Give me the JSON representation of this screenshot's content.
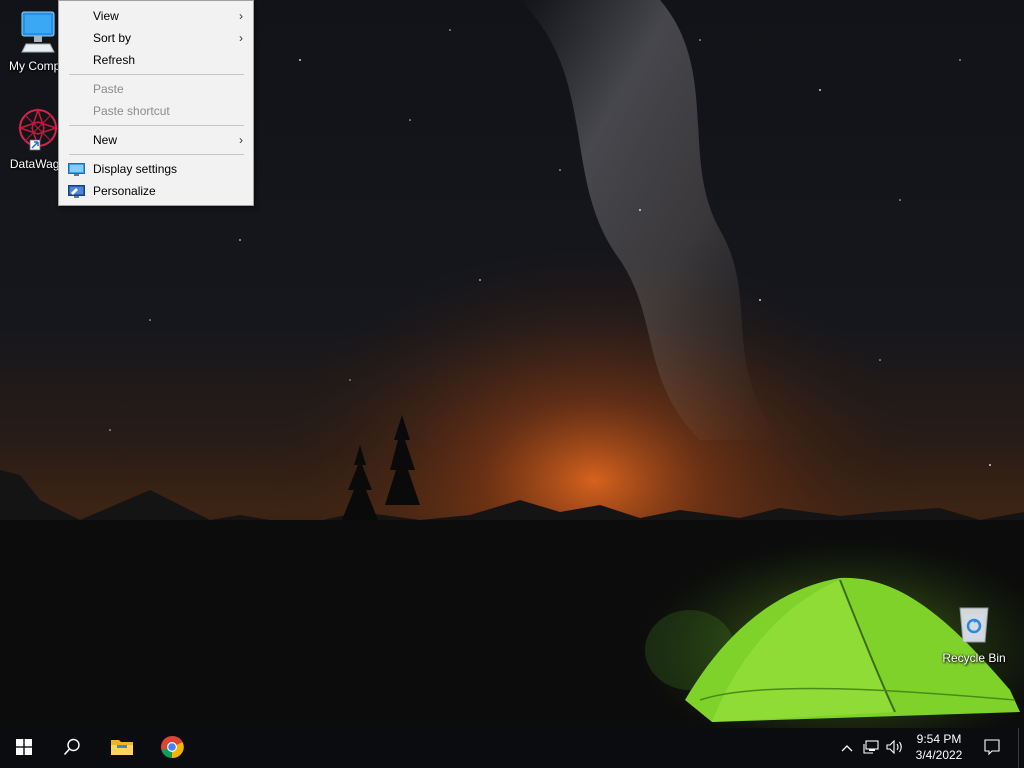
{
  "desktop": {
    "icons": [
      {
        "label": "My Compu",
        "icon": "my-computer-icon"
      },
      {
        "label": "DataWago",
        "icon": "datawagon-icon"
      },
      {
        "label": "Recycle Bin",
        "icon": "recycle-bin-icon"
      }
    ]
  },
  "context_menu": {
    "items": [
      {
        "label": "View",
        "submenu": true,
        "enabled": true
      },
      {
        "label": "Sort by",
        "submenu": true,
        "enabled": true
      },
      {
        "label": "Refresh",
        "enabled": true
      },
      {
        "label": "Paste",
        "enabled": false
      },
      {
        "label": "Paste shortcut",
        "enabled": false
      },
      {
        "label": "New",
        "submenu": true,
        "enabled": true
      },
      {
        "label": "Display settings",
        "icon": "display-settings-icon",
        "enabled": true
      },
      {
        "label": "Personalize",
        "icon": "personalize-icon",
        "enabled": true
      }
    ],
    "submenu_arrow": "›"
  },
  "taskbar": {
    "pinned": [
      "start-icon",
      "search-icon",
      "file-explorer-icon",
      "chrome-icon"
    ],
    "tray_icons": [
      "chevron-up-icon",
      "network-icon",
      "volume-icon"
    ],
    "clock": {
      "time": "9:54 PM",
      "date": "3/4/2022"
    },
    "notification_icon": "action-center-icon"
  },
  "colors": {
    "taskbar_bg": "#0b0c10",
    "menu_bg": "#f2f2f2",
    "menu_disabled_text": "#8c8c8c",
    "tent_green": "#7fd22a",
    "horizon_glow": "#d4541a"
  }
}
